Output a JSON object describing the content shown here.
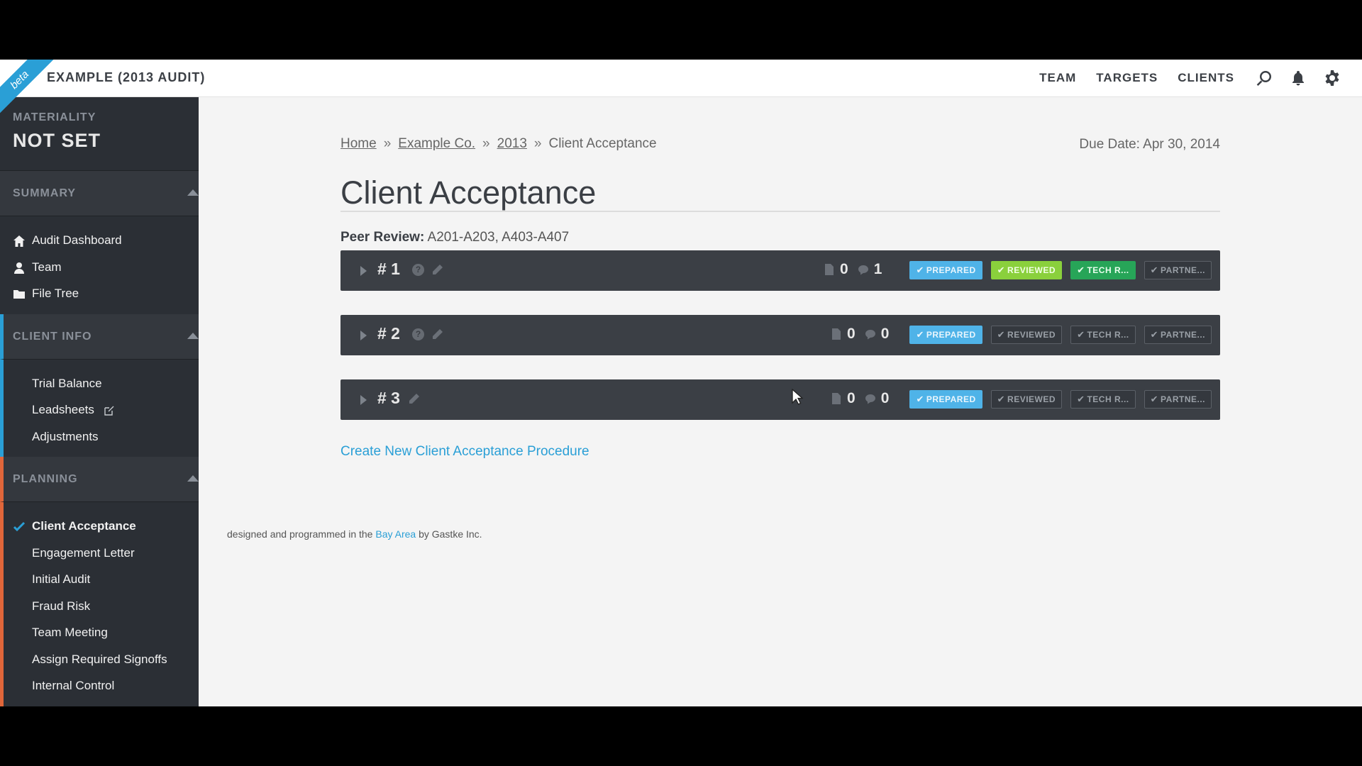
{
  "header": {
    "beta": "beta",
    "title": "EXAMPLE (2013 AUDIT)",
    "nav": [
      "TEAM",
      "TARGETS",
      "CLIENTS"
    ],
    "icons": [
      "search-icon",
      "bell-icon",
      "gear-icon"
    ]
  },
  "sidebar": {
    "materiality_label": "MATERIALITY",
    "materiality_value": "NOT SET",
    "summary": {
      "title": "SUMMARY",
      "items": [
        "Audit Dashboard",
        "Team",
        "File Tree"
      ]
    },
    "client_info": {
      "title": "CLIENT INFO",
      "items": [
        "Trial Balance",
        "Leadsheets",
        "Adjustments"
      ]
    },
    "planning": {
      "title": "PLANNING",
      "items": [
        "Client Acceptance",
        "Engagement Letter",
        "Initial Audit",
        "Fraud Risk",
        "Team Meeting",
        "Assign Required Signoffs",
        "Internal Control"
      ]
    }
  },
  "main": {
    "breadcrumb": [
      "Home",
      "Example Co.",
      "2013",
      "Client Acceptance"
    ],
    "breadcrumb_sep": "»",
    "due_date": "Due Date: Apr 30, 2014",
    "title": "Client Acceptance",
    "peer_label": "Peer Review:",
    "peer_value": "A201-A203, A403-A407",
    "procedures": [
      {
        "label": "# 1",
        "docs": "0",
        "comments": "1",
        "badges": [
          "PREPARED",
          "REVIEWED",
          "TECH R...",
          "PARTNE..."
        ]
      },
      {
        "label": "# 2",
        "docs": "0",
        "comments": "0",
        "badges": [
          "PREPARED",
          "REVIEWED",
          "TECH R...",
          "PARTNE..."
        ]
      },
      {
        "label": "# 3",
        "docs": "0",
        "comments": "0",
        "badges": [
          "PREPARED",
          "REVIEWED",
          "TECH R...",
          "PARTNE..."
        ]
      }
    ],
    "create_link": "Create New Client Acceptance Procedure"
  },
  "footer": {
    "prefix": "designed and programmed in the",
    "link": "Bay Area",
    "suffix": "by Gastke Inc."
  },
  "colors": {
    "accent_blue": "#2a9fd6",
    "planning_orange": "#e0663a",
    "prepared": "#4fb3e8",
    "reviewed": "#8ad03c",
    "tech_review": "#27a558"
  }
}
